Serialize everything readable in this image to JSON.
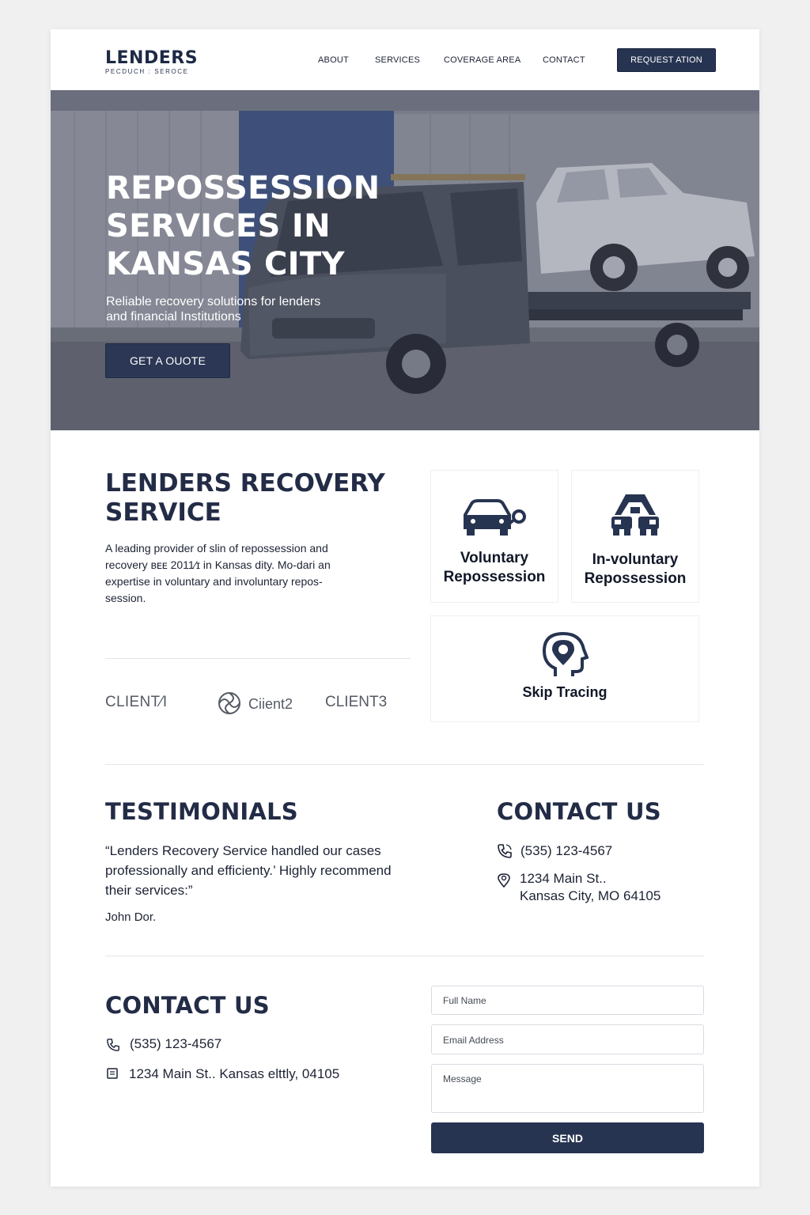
{
  "header": {
    "logo_main": "LENDERS",
    "logo_sub": "PECDUCH : SEROCE",
    "nav": [
      "ABOUT",
      "SERVICES",
      "COVERAGE AREA",
      "CONTACT"
    ],
    "cta_label": "REQUEST ATION"
  },
  "hero": {
    "title": "REPOSSESSION SERVICES IN KANSAS CITY",
    "subtitle": "Reliable recovery solutions for lenders and financial Institutions",
    "button_label": "GET A OUOTE"
  },
  "about": {
    "title": "LENDERS RECOVERY SERVICE",
    "text": "A leading provider of slin of repossession and recovery ʙᴇᴇ 2011⁄ɪ in Kansas dity. Mo-dari an expertise in voluntary and involuntary repos-session."
  },
  "clients": [
    "CLIENT⁄I",
    "Ciient2",
    "CLIENT3"
  ],
  "services": [
    {
      "label": "Voluntary Repossession",
      "icon": "car-key-icon"
    },
    {
      "label": "In-voluntary Repossession",
      "icon": "tow-vehicles-icon"
    },
    {
      "label": "Skip Tracing",
      "icon": "location-head-icon"
    }
  ],
  "testimonials": {
    "title": "TESTIMONIALS",
    "quote": "“Lenders Recovery Service handled our cases professionally and efficienty.’ Highly recommend their services:”",
    "author": "John Dor."
  },
  "contact_top": {
    "title": "CONTACT US",
    "phone": "(535) 123-4567",
    "address_line1": "1234 Main St..",
    "address_line2": "Kansas City, MO 64105"
  },
  "contact_bottom": {
    "title": "CONTACT US",
    "phone": "(535) 123-4567",
    "address": "1234 Main St.. Kansas elttly, 04105"
  },
  "form": {
    "name_placeholder": "Full Name",
    "email_placeholder": "Email Address",
    "message_placeholder": "Message",
    "send_label": "SEND"
  },
  "colors": {
    "navy": "#273451",
    "heading": "#232c46"
  }
}
